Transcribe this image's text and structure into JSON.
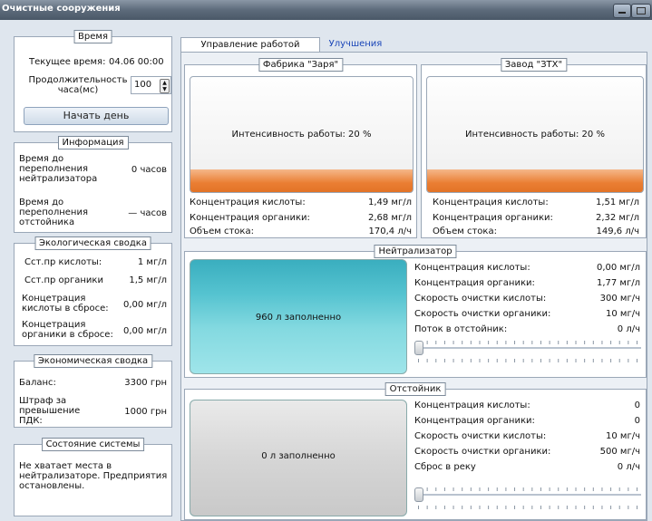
{
  "window": {
    "title": "Очистные сооружения"
  },
  "time": {
    "title": "Время",
    "current_label": "Текущее время:",
    "current_value": "04.06 00:00",
    "duration_label": "Продолжительность часа(мс)",
    "duration_value": "100",
    "start_button": "Начать день"
  },
  "info": {
    "title": "Информация",
    "neutralizer_overflow_label": "Время до переполнения нейтрализатора",
    "neutralizer_overflow_value": "0 часов",
    "settler_overflow_label": "Время до переполнения отстойника",
    "settler_overflow_value": "— часов"
  },
  "eco": {
    "title": "Экологическая сводка",
    "acid_norm_label": "Сст.пр кислоты:",
    "acid_norm_value": "1 мг/л",
    "organic_norm_label": "Сст.пр органики",
    "organic_norm_value": "1,5 мг/л",
    "acid_discharge_label": "Концетрация кислоты в сбросе:",
    "acid_discharge_value": "0,00 мг/л",
    "organic_discharge_label": "Концетрация органики в сбросе:",
    "organic_discharge_value": "0,00 мг/л"
  },
  "econ": {
    "title": "Экономическая сводка",
    "balance_label": "Баланс:",
    "balance_value": "3300 грн",
    "fine_label": "Штраф за превышение ПДК:",
    "fine_value": "1000 грн"
  },
  "status": {
    "title": "Состояние системы",
    "message": "Не хватает места в нейтрализаторе. Предприятия остановлены."
  },
  "tabs": [
    {
      "label": "Управление работой системы",
      "active": true
    },
    {
      "label": "Улучшения",
      "active": false
    }
  ],
  "factory1": {
    "title": "Фабрика \"Заря\"",
    "intensity_text": "Интенсивность работы: 20 %",
    "intensity_percent": 20,
    "acid_label": "Концентрация кислоты:",
    "acid_value": "1,49 мг/л",
    "organic_label": "Концентрация органики:",
    "organic_value": "2,68 мг/л",
    "flow_label": "Объем стока:",
    "flow_value": "170,4 л/ч"
  },
  "factory2": {
    "title": "Завод \"ЗТХ\"",
    "intensity_text": "Интенсивность работы: 20 %",
    "intensity_percent": 20,
    "acid_label": "Концентрация кислоты:",
    "acid_value": "1,51 мг/л",
    "organic_label": "Концентрация органики:",
    "organic_value": "2,32 мг/л",
    "flow_label": "Объем стока:",
    "flow_value": "149,6 л/ч"
  },
  "neutralizer": {
    "title": "Нейтрализатор",
    "fill_text": "960 л заполненно",
    "fill_fraction": 1.0,
    "acid_label": "Концентрация кислоты:",
    "acid_value": "0,00 мг/л",
    "organic_label": "Концентрация органики:",
    "organic_value": "1,77 мг/л",
    "acid_speed_label": "Скорость очистки кислоты:",
    "acid_speed_value": "300 мг/ч",
    "organic_speed_label": "Скорость очистки органики:",
    "organic_speed_value": "10 мг/ч",
    "flow_label": "Поток в отстойник:",
    "flow_value": "0 л/ч",
    "slider_fraction": 0
  },
  "settler": {
    "title": "Отстойник",
    "fill_text": "0 л заполненно",
    "fill_fraction": 0,
    "acid_label": "Концентрация кислоты:",
    "acid_value": "0",
    "organic_label": "Концентрация органики:",
    "organic_value": "0",
    "acid_speed_label": "Скорость очистки кислоты:",
    "acid_speed_value": "10 мг/ч",
    "organic_speed_label": "Скорость очистки органики:",
    "organic_speed_value": "500 мг/ч",
    "discharge_label": "Сброс в реку",
    "discharge_value": "0 л/ч",
    "slider_fraction": 0
  },
  "colors": {
    "accent_orange": "#ea7e33",
    "tank_teal": "#55c3d0",
    "tab_link": "#1a46b8"
  }
}
